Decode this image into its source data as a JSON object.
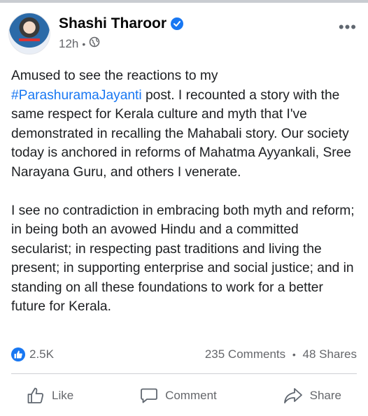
{
  "post": {
    "author": "Shashi Tharoor",
    "time": "12h",
    "separator": "•",
    "more_label": "•••",
    "paragraph1_line1": "Amused to see the reactions to my",
    "paragraph1_hashtag": "#ParashuramaJayanti",
    "paragraph1_rest": " post. I recounted a story with the same respect for Kerala culture and myth that I've demonstrated in recalling the Mahabali story. Our society today is anchored in reforms of Mahatma Ayyankali, Sree Narayana Guru, and others I venerate.",
    "paragraph2": "I see no contradiction in embracing both myth and reform; in being both an avowed Hindu and a committed secularist; in respecting past traditions and living the present; in supporting enterprise and social justice; and in standing on all these foundations to work for a better future for Kerala."
  },
  "stats": {
    "reactions": "2.5K",
    "comments": "235 Comments",
    "dot": "•",
    "shares": "48 Shares"
  },
  "actions": {
    "like": "Like",
    "comment": "Comment",
    "share": "Share"
  },
  "colors": {
    "accent": "#1877f2",
    "muted": "#65676b"
  }
}
